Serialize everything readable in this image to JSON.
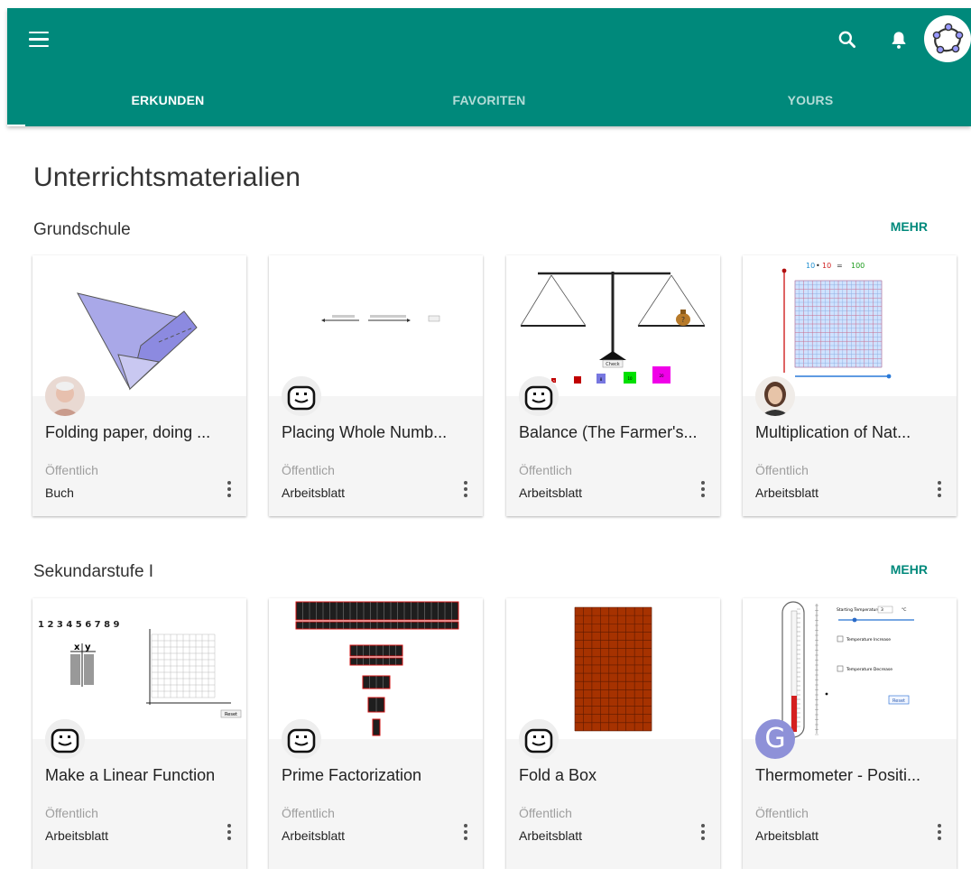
{
  "header": {
    "colors": {
      "primary": "#00897b",
      "accent": "#ffffff"
    },
    "menu_icon": "menu-icon",
    "search_icon": "search-icon",
    "bell_icon": "bell-icon",
    "avatar_icon": "geogebra-logo-icon",
    "tabs": [
      {
        "label": "ERKUNDEN",
        "active": true
      },
      {
        "label": "FAVORITEN",
        "active": false
      },
      {
        "label": "YOURS",
        "active": false
      }
    ]
  },
  "page": {
    "title": "Unterrichtsmaterialien",
    "sections": [
      {
        "title": "Grundschule",
        "more": "MEHR",
        "cards": [
          {
            "title": "Folding paper, doing ...",
            "visibility": "Öffentlich",
            "type": "Buch",
            "avatar": "photo-avatar"
          },
          {
            "title": "Placing Whole Numb...",
            "visibility": "Öffentlich",
            "type": "Arbeitsblatt",
            "avatar": "smiley-avatar"
          },
          {
            "title": "Balance (The Farmer's...",
            "visibility": "Öffentlich",
            "type": "Arbeitsblatt",
            "avatar": "smiley-avatar",
            "thumb_text": {
              "check": "Check",
              "w1": "5",
              "w2": "8",
              "w3": "10",
              "w4": "20",
              "bag": "?"
            }
          },
          {
            "title": "Multiplication of Nat...",
            "visibility": "Öffentlich",
            "type": "Arbeitsblatt",
            "avatar": "photo-avatar",
            "thumb_text": {
              "a": "10",
              "op": "•",
              "b": "10",
              "eq": "=",
              "c": "100"
            }
          }
        ]
      },
      {
        "title": "Sekundarstufe I",
        "more": "MEHR",
        "cards": [
          {
            "title": "Make a Linear Function",
            "visibility": "Öffentlich",
            "type": "Arbeitsblatt",
            "avatar": "smiley-avatar",
            "thumb_text": {
              "digits": "1 2 3 4 5 6 7 8 9",
              "x": "x",
              "y": "y",
              "reset": "Reset"
            }
          },
          {
            "title": "Prime Factorization",
            "visibility": "Öffentlich",
            "type": "Arbeitsblatt",
            "avatar": "smiley-avatar"
          },
          {
            "title": "Fold a Box",
            "visibility": "Öffentlich",
            "type": "Arbeitsblatt",
            "avatar": "smiley-avatar"
          },
          {
            "title": "Thermometer - Positi...",
            "visibility": "Öffentlich",
            "type": "Arbeitsblatt",
            "avatar": "letter-avatar",
            "avatar_letter": "G",
            "thumb_text": {
              "start": "Starting Temperature =",
              "unit": "°C",
              "start_val": "3",
              "inc": "Temperature Increase",
              "dec": "Temperature Decrease",
              "reset": "Reset"
            }
          }
        ]
      }
    ]
  }
}
